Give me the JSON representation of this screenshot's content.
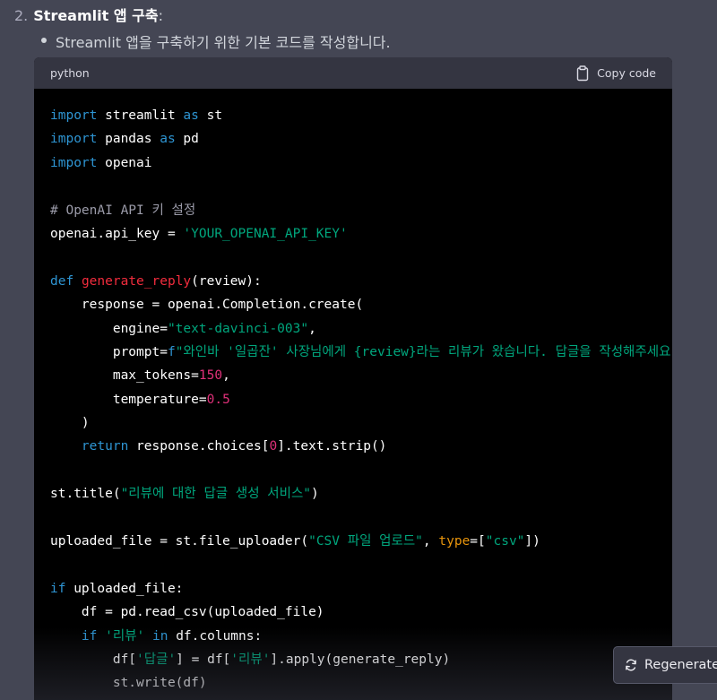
{
  "step": {
    "number": "2.",
    "title": "Streamlit 앱 구축",
    "suffix": ":"
  },
  "bullet": {
    "text": "Streamlit 앱을 구축하기 위한 기본 코드를 작성합니다."
  },
  "code_block": {
    "language": "python",
    "copy_label": "Copy code",
    "lines": [
      [
        {
          "t": "import",
          "c": "kw"
        },
        {
          "t": " streamlit "
        },
        {
          "t": "as",
          "c": "kw"
        },
        {
          "t": " st"
        }
      ],
      [
        {
          "t": "import",
          "c": "kw"
        },
        {
          "t": " pandas "
        },
        {
          "t": "as",
          "c": "kw"
        },
        {
          "t": " pd"
        }
      ],
      [
        {
          "t": "import",
          "c": "kw"
        },
        {
          "t": " openai"
        }
      ],
      [],
      [
        {
          "t": "# OpenAI API 키 설정",
          "c": "cm"
        }
      ],
      [
        {
          "t": "openai.api_key = "
        },
        {
          "t": "'YOUR_OPENAI_API_KEY'",
          "c": "str"
        }
      ],
      [],
      [
        {
          "t": "def",
          "c": "kw"
        },
        {
          "t": " "
        },
        {
          "t": "generate_reply",
          "c": "fn"
        },
        {
          "t": "(review):"
        }
      ],
      [
        {
          "t": "    response = openai.Completion.create("
        }
      ],
      [
        {
          "t": "        engine="
        },
        {
          "t": "\"text-davinci-003\"",
          "c": "str"
        },
        {
          "t": ","
        }
      ],
      [
        {
          "t": "        prompt="
        },
        {
          "t": "f",
          "c": "kw"
        },
        {
          "t": "\"와인바 '일곱잔' 사장님에게 {review}라는 리뷰가 왔습니다. 답글을 작성해주세요.\"",
          "c": "str"
        },
        {
          "t": ","
        }
      ],
      [
        {
          "t": "        max_tokens="
        },
        {
          "t": "150",
          "c": "num"
        },
        {
          "t": ","
        }
      ],
      [
        {
          "t": "        temperature="
        },
        {
          "t": "0.5",
          "c": "num"
        }
      ],
      [
        {
          "t": "    )"
        }
      ],
      [
        {
          "t": "    "
        },
        {
          "t": "return",
          "c": "kw"
        },
        {
          "t": " response.choices["
        },
        {
          "t": "0",
          "c": "num"
        },
        {
          "t": "].text.strip()"
        }
      ],
      [],
      [
        {
          "t": "st.title("
        },
        {
          "t": "\"리뷰에 대한 답글 생성 서비스\"",
          "c": "str"
        },
        {
          "t": ")"
        }
      ],
      [],
      [
        {
          "t": "uploaded_file = st.file_uploader("
        },
        {
          "t": "\"CSV 파일 업로드\"",
          "c": "str"
        },
        {
          "t": ", "
        },
        {
          "t": "type",
          "c": "prm"
        },
        {
          "t": "=["
        },
        {
          "t": "\"csv\"",
          "c": "str"
        },
        {
          "t": "])"
        }
      ],
      [],
      [
        {
          "t": "if",
          "c": "kw"
        },
        {
          "t": " uploaded_file:"
        }
      ],
      [
        {
          "t": "    df = pd.read_csv(uploaded_file)"
        }
      ],
      [
        {
          "t": "    "
        },
        {
          "t": "if",
          "c": "kw"
        },
        {
          "t": " "
        },
        {
          "t": "'리뷰'",
          "c": "str"
        },
        {
          "t": " "
        },
        {
          "t": "in",
          "c": "kw"
        },
        {
          "t": " df.columns:"
        }
      ],
      [
        {
          "t": "        df["
        },
        {
          "t": "'답글'",
          "c": "str"
        },
        {
          "t": "] = df["
        },
        {
          "t": "'리뷰'",
          "c": "str"
        },
        {
          "t": "].apply(generate_reply)"
        }
      ],
      [
        {
          "t": "        st.write(df)"
        }
      ]
    ]
  },
  "regenerate_button": {
    "label": "Regenerate"
  },
  "colors": {
    "page_bg": "#444654",
    "code_bg": "#000000",
    "code_header_bg": "#343541",
    "keyword": "#2e95d3",
    "function": "#f22c3d",
    "string": "#00a67d",
    "number": "#df3079",
    "comment": "#9b9ba9",
    "param": "#e9950c"
  },
  "icons": {
    "copy": "clipboard-icon",
    "regenerate": "refresh-icon"
  }
}
